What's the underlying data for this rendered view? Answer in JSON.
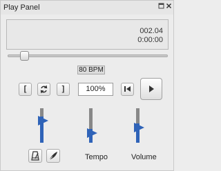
{
  "panel": {
    "title": "Play Panel",
    "float_icon": "float-icon",
    "close_icon": "close-icon"
  },
  "display": {
    "measure_beat": "002.04",
    "time": "0:00:00"
  },
  "position_slider": {
    "value_fraction": 0.08
  },
  "tempo_readout": "80 BPM",
  "loop_controls": {
    "loop_in_label": "[",
    "loop_toggle_icon": "loop-icon",
    "loop_out_label": "]"
  },
  "tempo_percent": "100%",
  "transport": {
    "rewind_icon": "rewind-to-start-icon",
    "play_icon": "play-icon"
  },
  "mixer": {
    "metronome_level": 0.75,
    "tempo_level": 0.4,
    "volume_level": 0.55,
    "tempo_label": "Tempo",
    "volume_label": "Volume",
    "metronome_icon": "metronome-icon",
    "count_in_icon": "quill-icon"
  },
  "colors": {
    "accent": "#2f63b8"
  }
}
